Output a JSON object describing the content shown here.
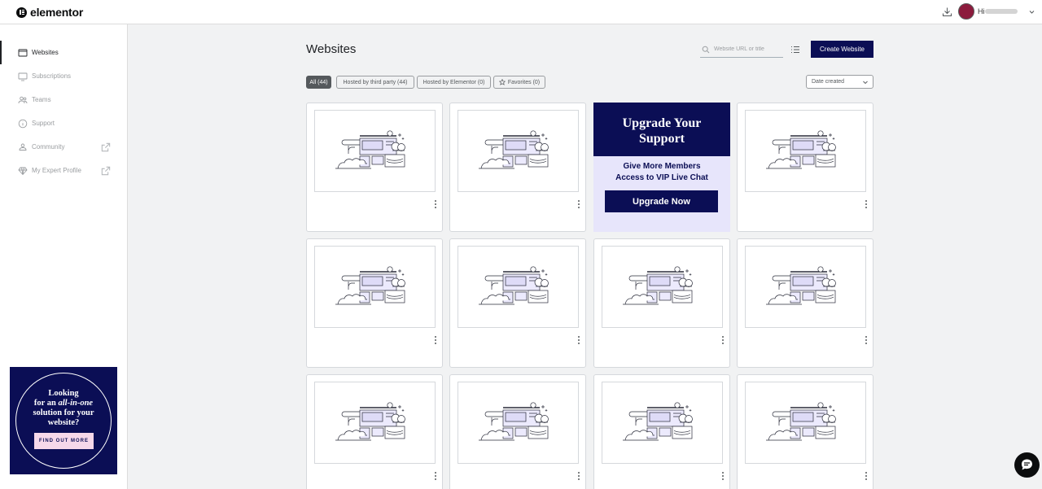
{
  "app": {
    "brand": "elementor"
  },
  "header": {
    "greeting": "Hi"
  },
  "sidebar": {
    "items": [
      {
        "label": "Websites",
        "icon": "browser-icon",
        "active": true
      },
      {
        "label": "Subscriptions",
        "icon": "monitor-icon",
        "active": false
      },
      {
        "label": "Teams",
        "icon": "people-icon",
        "active": false
      },
      {
        "label": "Support",
        "icon": "info-icon",
        "active": false
      },
      {
        "label": "Community",
        "icon": "community-icon",
        "active": false,
        "external": true
      },
      {
        "label": "My Expert Profile",
        "icon": "diamond-icon",
        "active": false,
        "external": true
      }
    ],
    "promo": {
      "line1": "Looking",
      "line2_pre": "for an ",
      "line2_em": "all-in-one",
      "line3": "solution for your",
      "line4": "website?",
      "cta": "FIND OUT MORE"
    }
  },
  "main": {
    "title": "Websites",
    "search_placeholder": "Website URL or title",
    "create_button": "Create Website",
    "filters": [
      {
        "label": "All (44)",
        "active": true
      },
      {
        "label": "Hosted by third party (44)",
        "active": false
      },
      {
        "label": "Hosted by Elementor (0)",
        "active": false
      },
      {
        "label": "Favorites (0)",
        "active": false,
        "icon": "star-icon"
      }
    ],
    "sort": {
      "selected": "Date created"
    },
    "upgrade_card": {
      "title_line1": "Upgrade Your",
      "title_line2": "Support",
      "sub_line1": "Give More Members",
      "sub_line2": "Access to VIP Live Chat",
      "button": "Upgrade Now"
    },
    "website_card_count": 11
  },
  "colors": {
    "brand_navy": "#0b0e55",
    "upgrade_bg": "#e7e5fb",
    "page_bg": "#f1f2f3",
    "avatar": "#8c1b3d"
  }
}
